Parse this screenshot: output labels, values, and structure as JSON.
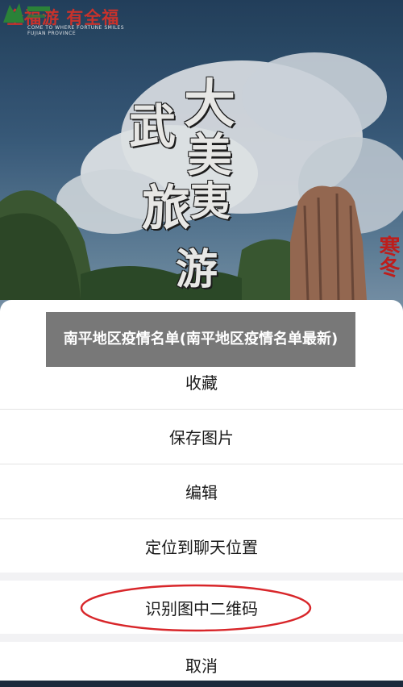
{
  "poster": {
    "brand": "全福游 有全福",
    "brand_sub": "COME TO WHERE FORTUNE SMILES FUJIAN PROVINCE",
    "calligraphy": [
      "大",
      "美",
      "武",
      "夷",
      "旅",
      "游"
    ],
    "side_text": "寒冬"
  },
  "caption": {
    "text": "南平地区疫情名单(南平地区疫情名单最新)"
  },
  "menu": {
    "items": [
      {
        "label": "收藏"
      },
      {
        "label": "保存图片"
      },
      {
        "label": "编辑"
      },
      {
        "label": "定位到聊天位置"
      },
      {
        "label": "识别图中二维码"
      },
      {
        "label": "取消"
      }
    ]
  },
  "colors": {
    "annotation_circle": "#d8262a",
    "sheet_bg": "#ffffff",
    "separator": "#e3e3e3"
  }
}
